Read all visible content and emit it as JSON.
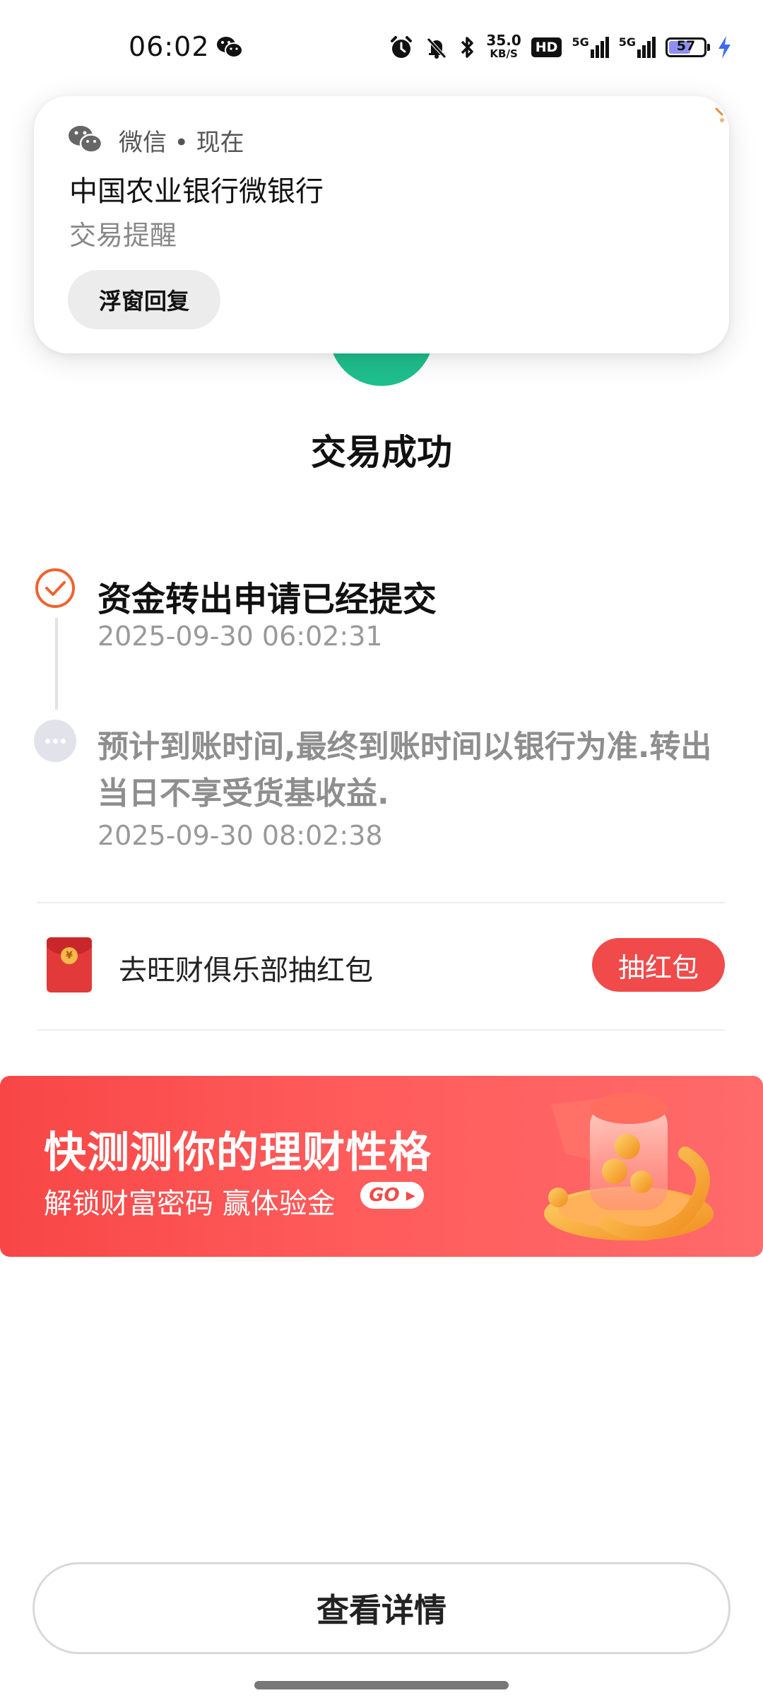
{
  "status_bar": {
    "time": "06:02",
    "net_speed_value": "35.0",
    "net_speed_unit": "KB/S",
    "hd_label": "HD",
    "signal1_label": "5G",
    "signal2_label": "5G",
    "battery_level": "57",
    "icons": [
      "wechat-icon",
      "alarm-icon",
      "mute-icon",
      "bluetooth-icon",
      "signal-icon",
      "battery-icon",
      "charging-icon"
    ]
  },
  "notification": {
    "app_name": "微信 • 现在",
    "title": "中国农业银行微银行",
    "subtitle": "交易提醒",
    "reply_button": "浮窗回复"
  },
  "result": {
    "title": "交易成功",
    "accent_color": "#1fbf8c"
  },
  "timeline": [
    {
      "title": "资金转出申请已经提交",
      "time": "2025-09-30 06:02:31",
      "state": "done"
    },
    {
      "title": "预计到账时间,最终到账时间以银行为准.转出当日不享受货基收益.",
      "time": "2025-09-30 08:02:38",
      "state": "pending"
    }
  ],
  "red_packet": {
    "label": "去旺财俱乐部抽红包",
    "button": "抽红包",
    "color": "#f04a4a"
  },
  "banner": {
    "title": "快测测你的理财性格",
    "subtitle": "解锁财富密码 赢体验金",
    "go_label": "GO"
  },
  "footer": {
    "detail_button": "查看详情"
  }
}
